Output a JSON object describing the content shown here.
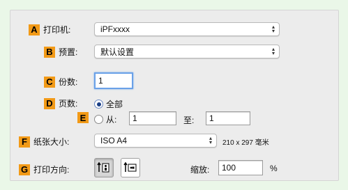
{
  "printer": {
    "badge": "A",
    "label": "打印机:",
    "value": "iPFxxxx"
  },
  "preset": {
    "badge": "B",
    "label": "预置:",
    "value": "默认设置"
  },
  "copies": {
    "badge": "C",
    "label": "份数:",
    "value": "1"
  },
  "pages": {
    "badge": "D",
    "label": "页数:",
    "all_label": "全部",
    "range_badge": "E",
    "from_label": "从:",
    "from_value": "1",
    "to_label": "至:",
    "to_value": "1",
    "selected": "all"
  },
  "paper_size": {
    "badge": "F",
    "label": "纸张大小:",
    "value": "ISO A4",
    "dimensions": "210 x 297 毫米"
  },
  "orientation": {
    "badge": "G",
    "label": "打印方向:",
    "portrait_icon": "portrait-orientation-icon",
    "landscape_icon": "landscape-orientation-icon",
    "selected": "portrait"
  },
  "scale": {
    "label": "缩放:",
    "value": "100",
    "unit": "%"
  },
  "colors": {
    "badge": "#f29a17",
    "background": "#eaf7e8",
    "panel": "#ececec",
    "focus": "#6aa1e8"
  }
}
